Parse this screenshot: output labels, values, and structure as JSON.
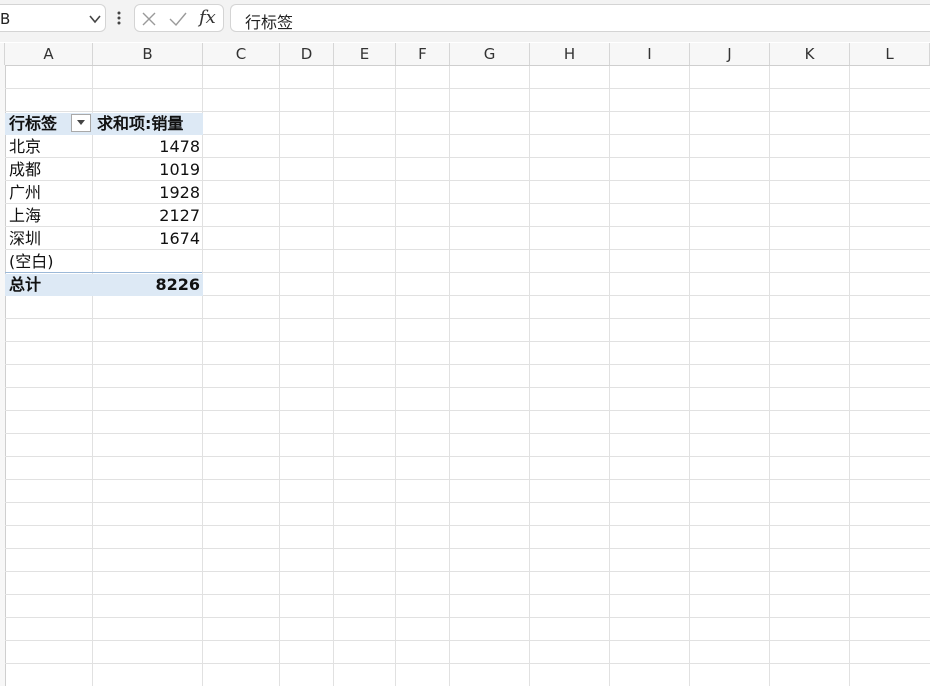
{
  "formula_bar": {
    "name_box": "B",
    "fx_label": "fx",
    "formula": "行标签"
  },
  "columns": [
    "A",
    "B",
    "C",
    "D",
    "E",
    "F",
    "G",
    "H",
    "I",
    "J",
    "K",
    "L"
  ],
  "pivot": {
    "row_label_header": "行标签",
    "value_header": "求和项:销量",
    "rows": [
      {
        "label": "北京",
        "value": "1478"
      },
      {
        "label": "成都",
        "value": "1019"
      },
      {
        "label": "广州",
        "value": "1928"
      },
      {
        "label": "上海",
        "value": "2127"
      },
      {
        "label": "深圳",
        "value": "1674"
      },
      {
        "label": "(空白)",
        "value": ""
      }
    ],
    "total_label": "总计",
    "total_value": "8226"
  }
}
